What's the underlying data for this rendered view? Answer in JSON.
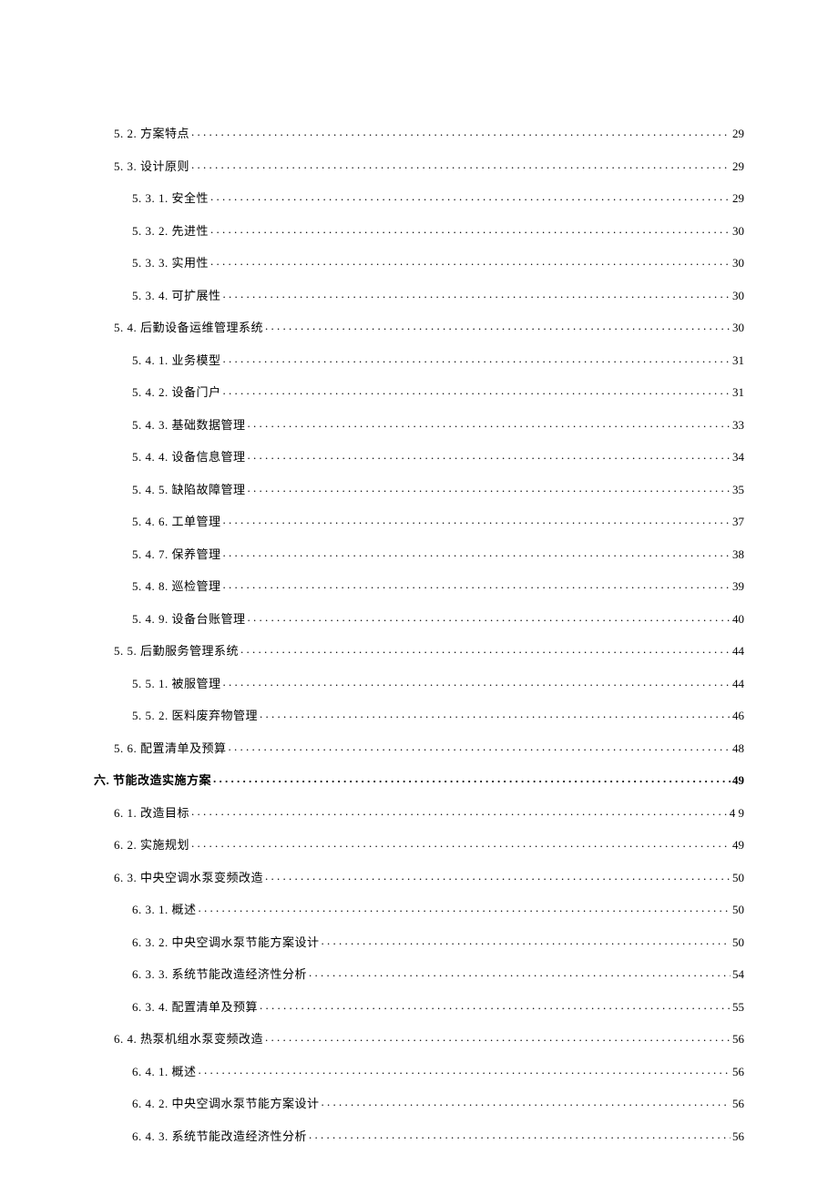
{
  "toc": [
    {
      "level": 1,
      "num": "5. 2.",
      "title": "方案特点",
      "page": "29",
      "bold": false
    },
    {
      "level": 1,
      "num": "5. 3.",
      "title": "设计原则",
      "page": "29",
      "bold": false
    },
    {
      "level": 2,
      "num": "5. 3. 1.",
      "title": "安全性",
      "page": "29",
      "bold": false
    },
    {
      "level": 2,
      "num": "5. 3. 2.",
      "title": "先进性",
      "page": "30",
      "bold": false
    },
    {
      "level": 2,
      "num": "5. 3. 3.",
      "title": "实用性",
      "page": "30",
      "bold": false
    },
    {
      "level": 2,
      "num": "5. 3. 4.",
      "title": "可扩展性",
      "page": "30",
      "bold": false
    },
    {
      "level": 1,
      "num": "5. 4.",
      "title": "后勤设备运维管理系统",
      "page": "30",
      "bold": false
    },
    {
      "level": 2,
      "num": "5.   4. 1.",
      "title": "业务模型",
      "page": "31",
      "bold": false
    },
    {
      "level": 2,
      "num": "5. 4. 2.",
      "title": "设备门户",
      "page": "31",
      "bold": false
    },
    {
      "level": 2,
      "num": "5. 4. 3.",
      "title": "基础数据管理",
      "page": "33",
      "bold": false
    },
    {
      "level": 2,
      "num": "5. 4. 4.",
      "title": "设备信息管理",
      "page": "34",
      "bold": false
    },
    {
      "level": 2,
      "num": "5. 4. 5.",
      "title": "缺陷故障管理",
      "page": "35",
      "bold": false
    },
    {
      "level": 2,
      "num": "5. 4. 6.",
      "title": "工单管理",
      "page": "37",
      "bold": false
    },
    {
      "level": 2,
      "num": "5. 4. 7.",
      "title": "保养管理",
      "page": "38",
      "bold": false
    },
    {
      "level": 2,
      "num": "5. 4. 8.",
      "title": "巡检管理",
      "page": "39",
      "bold": false
    },
    {
      "level": 2,
      "num": "5. 4. 9.",
      "title": "设备台账管理",
      "page": "40",
      "bold": false
    },
    {
      "level": 1,
      "num": "5. 5.",
      "title": "后勤服务管理系统",
      "page": "44",
      "bold": false
    },
    {
      "level": 2,
      "num": "5. 5. 1.",
      "title": "被服管理",
      "page": "44",
      "bold": false
    },
    {
      "level": 2,
      "num": "5. 5. 2.",
      "title": "医料废弃物管理",
      "page": "46",
      "bold": false
    },
    {
      "level": 1,
      "num": "5. 6.",
      "title": "配置清单及预算",
      "page": "48",
      "bold": false
    },
    {
      "level": 0,
      "num": "六.",
      "title": "节能改造实施方案",
      "page": "49",
      "bold": true
    },
    {
      "level": 1,
      "num": "6. 1.",
      "title": "改造目标",
      "page": "49",
      "bold": false,
      "pageSpaced": true
    },
    {
      "level": 1,
      "num": "6. 2.",
      "title": "实施规划",
      "page": "49",
      "bold": false
    },
    {
      "level": 1,
      "num": "6. 3.",
      "title": "中央空调水泵变频改造",
      "page": "50",
      "bold": false
    },
    {
      "level": 2,
      "num": "6. 3. 1.",
      "title": "概述",
      "page": "50",
      "bold": false
    },
    {
      "level": 2,
      "num": "6. 3. 2.",
      "title": "中央空调水泵节能方案设计",
      "page": "50",
      "bold": false
    },
    {
      "level": 2,
      "num": "6. 3. 3.",
      "title": "系统节能改造经济性分析",
      "page": "54",
      "bold": false
    },
    {
      "level": 2,
      "num": "6. 3. 4.",
      "title": "配置清单及预算",
      "page": "55",
      "bold": false
    },
    {
      "level": 1,
      "num": "6. 4.",
      "title": "热泵机组水泵变频改造",
      "page": "56",
      "bold": false
    },
    {
      "level": 2,
      "num": "6. 4. 1.",
      "title": "概述",
      "page": "56",
      "bold": false
    },
    {
      "level": 2,
      "num": "6. 4. 2.",
      "title": "中央空调水泵节能方案设计",
      "page": "56",
      "bold": false
    },
    {
      "level": 2,
      "num": "6. 4. 3.",
      "title": "系统节能改造经济性分析",
      "page": "56",
      "bold": false
    }
  ]
}
